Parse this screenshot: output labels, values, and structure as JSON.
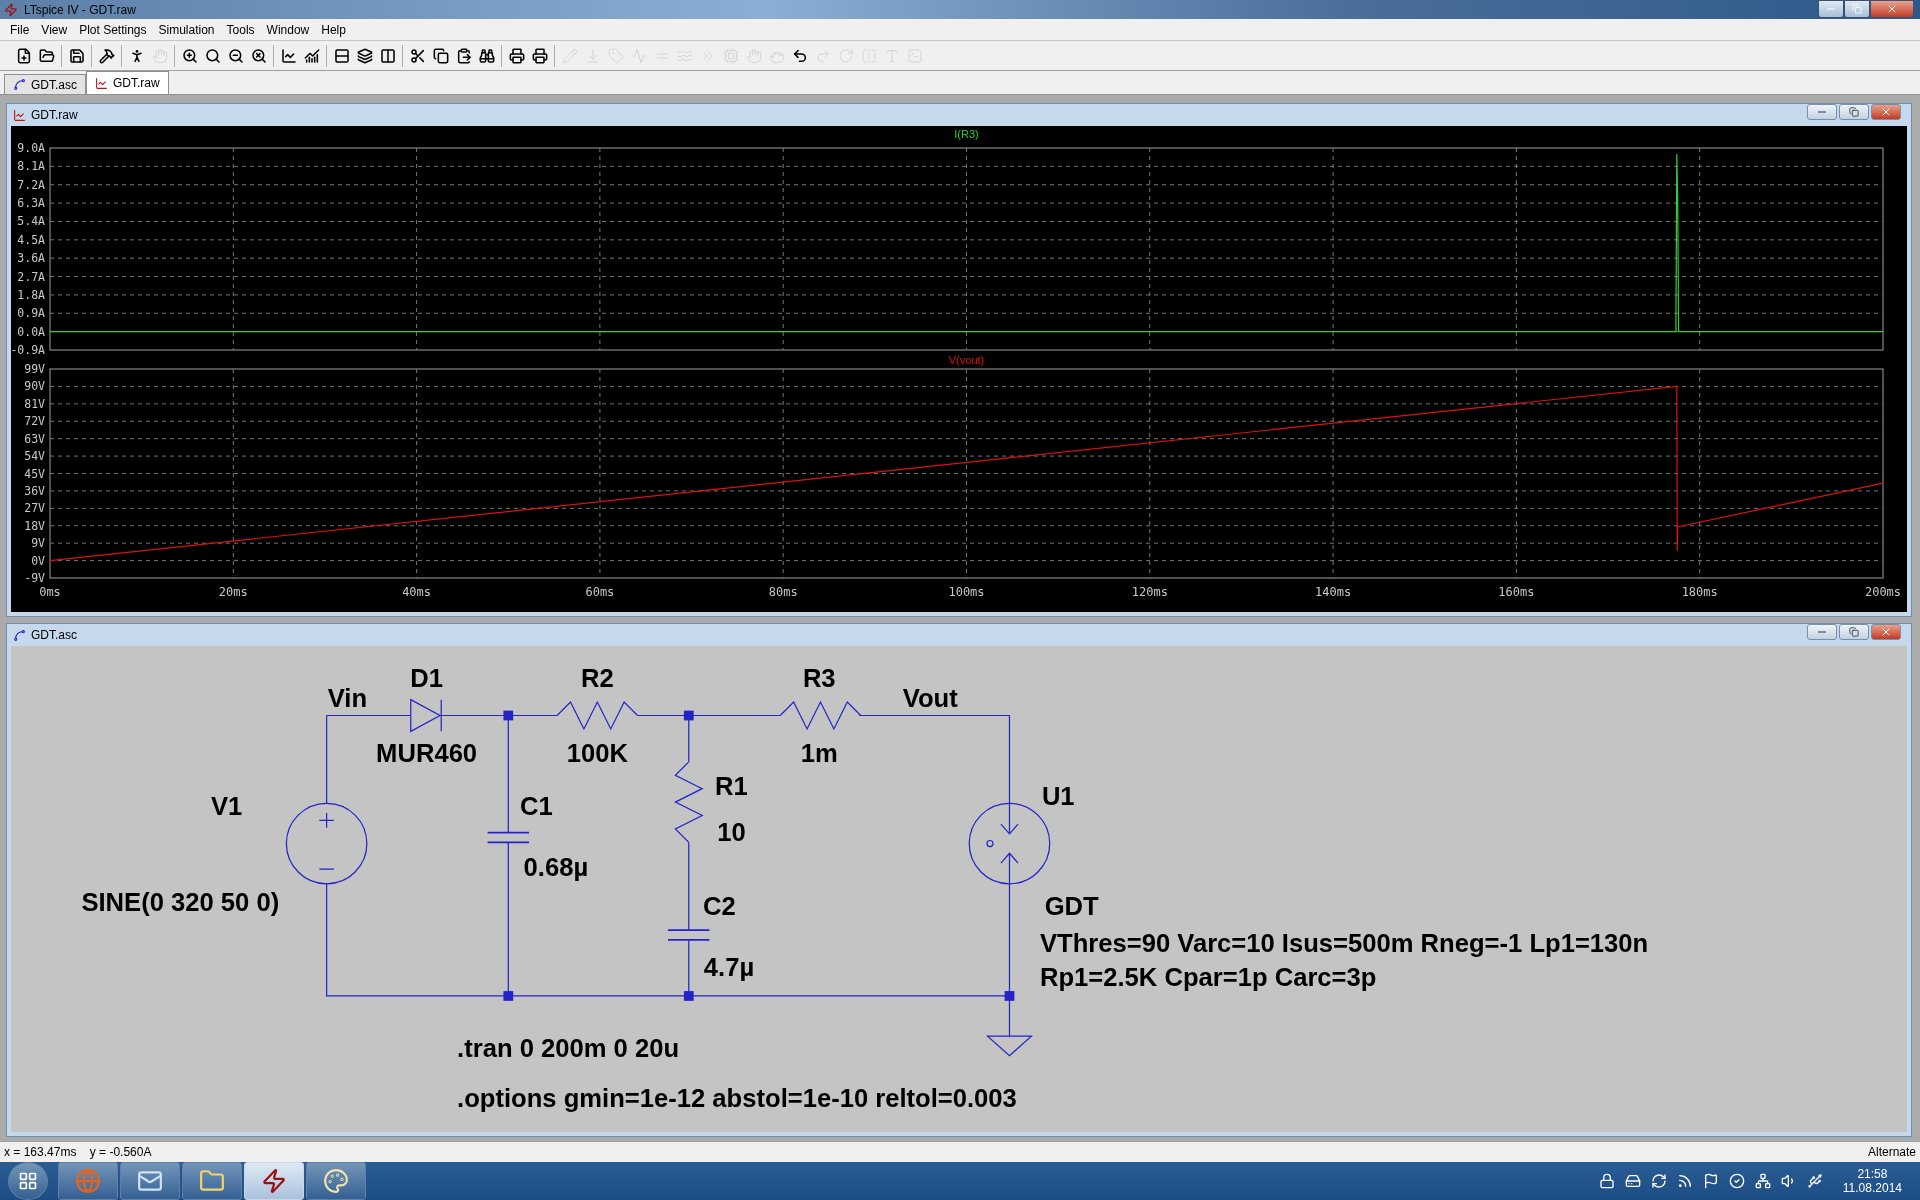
{
  "window": {
    "title": "LTspice IV - GDT.raw"
  },
  "menu": [
    "File",
    "View",
    "Plot Settings",
    "Simulation",
    "Tools",
    "Window",
    "Help"
  ],
  "toolbar": [
    {
      "kind": "new",
      "disabled": false
    },
    {
      "kind": "open",
      "disabled": false
    },
    {
      "kind": "sep"
    },
    {
      "kind": "save",
      "disabled": false
    },
    {
      "kind": "sep"
    },
    {
      "kind": "control",
      "disabled": false
    },
    {
      "kind": "sep"
    },
    {
      "kind": "run",
      "disabled": false
    },
    {
      "kind": "halt",
      "disabled": true
    },
    {
      "kind": "sep"
    },
    {
      "kind": "zoomin",
      "disabled": false
    },
    {
      "kind": "zoomarea",
      "disabled": false
    },
    {
      "kind": "zoomout",
      "disabled": false
    },
    {
      "kind": "zoomfit",
      "disabled": false
    },
    {
      "kind": "sep"
    },
    {
      "kind": "plotadd",
      "disabled": false
    },
    {
      "kind": "plotdel",
      "disabled": false
    },
    {
      "kind": "sep"
    },
    {
      "kind": "tileh",
      "disabled": false
    },
    {
      "kind": "cascade",
      "disabled": false
    },
    {
      "kind": "tilev",
      "disabled": false
    },
    {
      "kind": "sep"
    },
    {
      "kind": "cut",
      "disabled": false
    },
    {
      "kind": "copy",
      "disabled": false
    },
    {
      "kind": "paste",
      "disabled": false
    },
    {
      "kind": "find",
      "disabled": false
    },
    {
      "kind": "sep"
    },
    {
      "kind": "printsetup",
      "disabled": false
    },
    {
      "kind": "print",
      "disabled": false
    },
    {
      "kind": "sep"
    },
    {
      "kind": "wire",
      "disabled": true
    },
    {
      "kind": "ground",
      "disabled": true
    },
    {
      "kind": "label",
      "disabled": true
    },
    {
      "kind": "resistor",
      "disabled": true
    },
    {
      "kind": "capacitor",
      "disabled": true
    },
    {
      "kind": "inductor",
      "disabled": true
    },
    {
      "kind": "diode",
      "disabled": true
    },
    {
      "kind": "component",
      "disabled": true
    },
    {
      "kind": "move",
      "disabled": true
    },
    {
      "kind": "drag",
      "disabled": true
    },
    {
      "kind": "undo",
      "disabled": false
    },
    {
      "kind": "redo",
      "disabled": true
    },
    {
      "kind": "rotate",
      "disabled": true
    },
    {
      "kind": "mirror",
      "disabled": true
    },
    {
      "kind": "text",
      "disabled": true
    },
    {
      "kind": "directive",
      "disabled": true
    }
  ],
  "tabs": [
    {
      "label": "GDT.asc",
      "kind": "schematic",
      "selected": false
    },
    {
      "label": "GDT.raw",
      "kind": "waveform",
      "selected": true
    }
  ],
  "plot_window": {
    "title": "GDT.raw",
    "panes": [
      {
        "chart_data": {
          "type": "line",
          "x": [
            0,
            177.4,
            177.5,
            177.6,
            177.7,
            200
          ],
          "series": [
            {
              "name": "I(R3)",
              "color": "#33cc33",
              "values": [
                0,
                0,
                8.7,
                6.5,
                0,
                0
              ]
            }
          ],
          "xlim": [
            0,
            200
          ],
          "ylim": [
            -0.9,
            9.0
          ],
          "grid": true,
          "yticks": [
            {
              "value": 9.0,
              "label": "9.0A"
            },
            {
              "value": 8.1,
              "label": "8.1A"
            },
            {
              "value": 7.2,
              "label": "7.2A"
            },
            {
              "value": 6.3,
              "label": "6.3A"
            },
            {
              "value": 5.4,
              "label": "5.4A"
            },
            {
              "value": 4.5,
              "label": "4.5A"
            },
            {
              "value": 3.6,
              "label": "3.6A"
            },
            {
              "value": 2.7,
              "label": "2.7A"
            },
            {
              "value": 1.8,
              "label": "1.8A"
            },
            {
              "value": 0.9,
              "label": "0.9A"
            },
            {
              "value": 0.0,
              "label": "0.0A"
            },
            {
              "value": -0.9,
              "label": "-0.9A"
            }
          ]
        }
      },
      {
        "chart_data": {
          "type": "line",
          "x": [
            0,
            177.5,
            177.55,
            177.6,
            177.7,
            200
          ],
          "series": [
            {
              "name": "V(vout)",
              "color": "#dd1111",
              "values": [
                0,
                90,
                5,
                17,
                17.5,
                40
              ]
            }
          ],
          "xlim": [
            0,
            200
          ],
          "ylim": [
            -9,
            99
          ],
          "grid": true,
          "xticks": [
            {
              "value": 0,
              "label": "0ms"
            },
            {
              "value": 20,
              "label": "20ms"
            },
            {
              "value": 40,
              "label": "40ms"
            },
            {
              "value": 60,
              "label": "60ms"
            },
            {
              "value": 80,
              "label": "80ms"
            },
            {
              "value": 100,
              "label": "100ms"
            },
            {
              "value": 120,
              "label": "120ms"
            },
            {
              "value": 140,
              "label": "140ms"
            },
            {
              "value": 160,
              "label": "160ms"
            },
            {
              "value": 180,
              "label": "180ms"
            },
            {
              "value": 200,
              "label": "200ms"
            }
          ],
          "yticks": [
            {
              "value": 99,
              "label": "99V"
            },
            {
              "value": 90,
              "label": "90V"
            },
            {
              "value": 81,
              "label": "81V"
            },
            {
              "value": 72,
              "label": "72V"
            },
            {
              "value": 63,
              "label": "63V"
            },
            {
              "value": 54,
              "label": "54V"
            },
            {
              "value": 45,
              "label": "45V"
            },
            {
              "value": 36,
              "label": "36V"
            },
            {
              "value": 27,
              "label": "27V"
            },
            {
              "value": 18,
              "label": "18V"
            },
            {
              "value": 9,
              "label": "9V"
            },
            {
              "value": 0,
              "label": "0V"
            },
            {
              "value": -9,
              "label": "-9V"
            }
          ]
        }
      }
    ]
  },
  "schematic_window": {
    "title": "GDT.asc",
    "net_labels": [
      "Vin",
      "Vout"
    ],
    "components": [
      {
        "kind": "source",
        "ref": "V1",
        "value": "SINE(0 320 50 0)"
      },
      {
        "kind": "diode",
        "ref": "D1",
        "value": "MUR460"
      },
      {
        "kind": "resistor",
        "ref": "R2",
        "value": "100K"
      },
      {
        "kind": "resistor",
        "ref": "R3",
        "value": "1m"
      },
      {
        "kind": "capacitor",
        "ref": "C1",
        "value": "0.68µ"
      },
      {
        "kind": "resistor",
        "ref": "R1",
        "value": "10"
      },
      {
        "kind": "capacitor",
        "ref": "C2",
        "value": "4.7µ"
      },
      {
        "kind": "gdt",
        "ref": "U1",
        "value": "GDT",
        "params": [
          "VThres=90 Varc=10 Isus=500m Rneg=-1 Lp1=130n",
          "Rp1=2.5K Cpar=1p Carc=3p"
        ]
      }
    ],
    "directives": [
      ".tran 0 200m 0 20u",
      ".options gmin=1e-12 abstol=1e-10 reltol=0.003"
    ]
  },
  "status_bar": {
    "cursor": "x = 163.47ms    y = -0.560A",
    "mode": "Alternate"
  },
  "taskbar": {
    "apps": [
      {
        "kind": "browser",
        "selected": false
      },
      {
        "kind": "mail",
        "selected": false
      },
      {
        "kind": "explorer",
        "selected": false
      },
      {
        "kind": "ltspice",
        "selected": true
      },
      {
        "kind": "paint",
        "selected": false
      }
    ],
    "clock": {
      "time": "21:58",
      "date": "11.08.2014"
    }
  }
}
